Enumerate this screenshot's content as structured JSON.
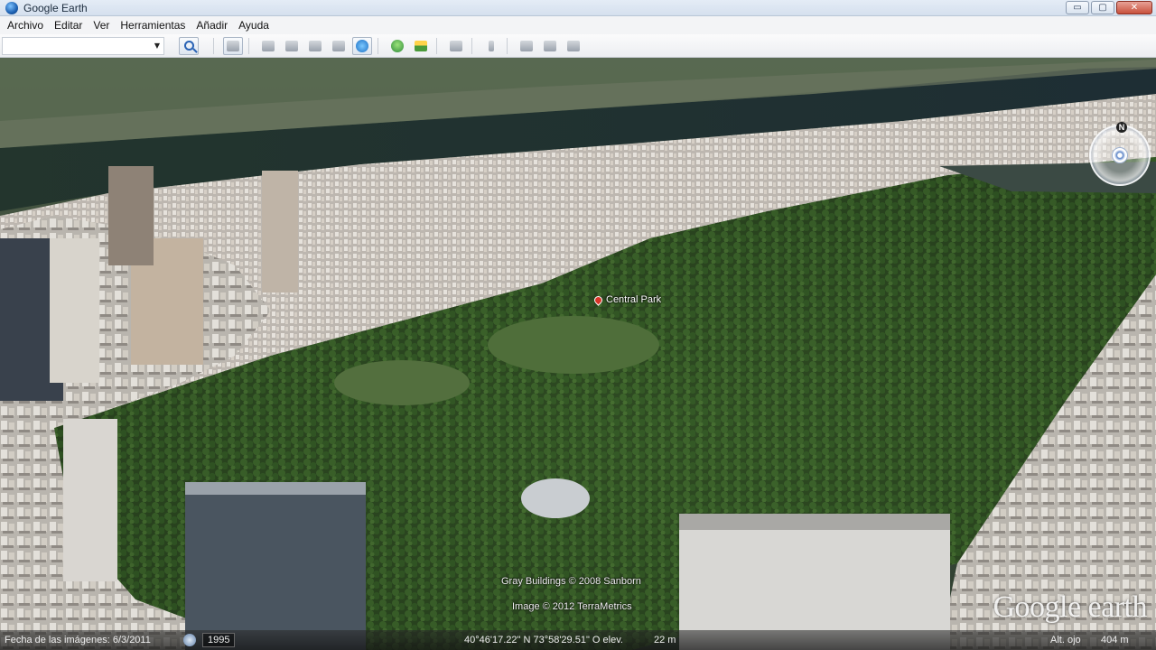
{
  "window": {
    "title": "Google Earth",
    "controls": {
      "minimize": "▭",
      "maximize": "▢",
      "close": "✕"
    }
  },
  "menu": {
    "items": [
      {
        "label": "Archivo"
      },
      {
        "label": "Editar"
      },
      {
        "label": "Ver"
      },
      {
        "label": "Herramientas"
      },
      {
        "label": "Añadir"
      },
      {
        "label": "Ayuda"
      }
    ]
  },
  "toolbar": {
    "search_value": "",
    "icons": [
      "search-icon",
      "sidebar-icon",
      "placemark-icon",
      "polygon-icon",
      "path-icon",
      "overlay-icon",
      "record-tour-icon",
      "historical-imagery-icon",
      "sunlight-icon",
      "planets-icon",
      "ruler-icon",
      "email-icon",
      "print-icon",
      "save-image-icon"
    ]
  },
  "map": {
    "placemark": "Central Park",
    "credits": {
      "buildings": "Gray Buildings © 2008 Sanborn",
      "image": "Image © 2012 TerraMetrics"
    },
    "logo": "Google earth",
    "compass_north": "N"
  },
  "status": {
    "imagery_date": "Fecha de las imágenes: 6/3/2011",
    "year": "1995",
    "coordinates": "40°46'17.22\" N  73°58'29.51\" O  elev.",
    "elevation": "22 m",
    "eye_alt_label": "Alt. ojo",
    "eye_alt": "404 m"
  },
  "colors": {
    "park": "#2f4a22",
    "water": "#27382f",
    "buildings": "#c9c4bd"
  }
}
